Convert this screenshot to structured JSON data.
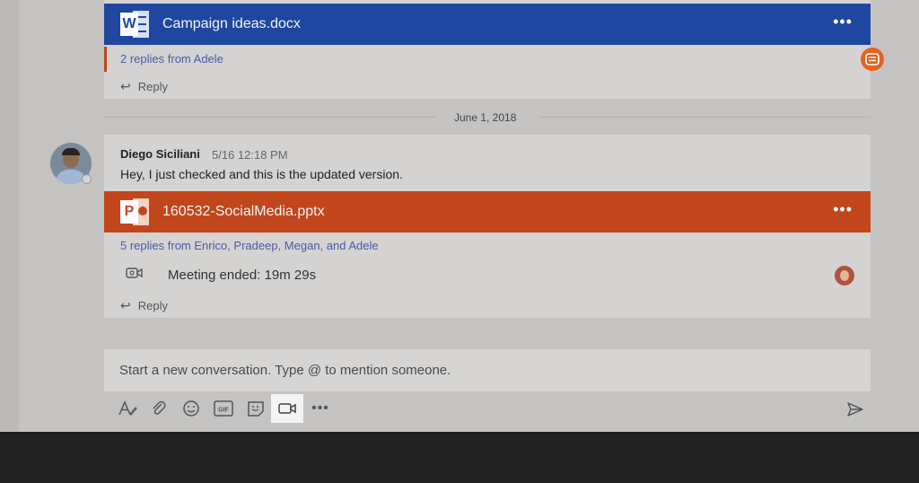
{
  "thread_top": {
    "file_name": "Campaign ideas.docx",
    "file_type": "word",
    "more_label": "•••",
    "replies_text": "2 replies from Adele",
    "reply_label": "Reply"
  },
  "date_divider": "June 1, 2018",
  "thread_main": {
    "sender": "Diego Siciliani",
    "time": "5/16 12:18 PM",
    "message": "Hey, I just checked and this is the updated version.",
    "file_name": "160532-SocialMedia.pptx",
    "file_type": "powerpoint",
    "more_label": "•••",
    "replies_text": "5 replies from Enrico, Pradeep, Megan, and Adele",
    "meeting_text": "Meeting ended: 19m 29s",
    "reply_label": "Reply"
  },
  "compose": {
    "placeholder": "Start a new conversation. Type @ to mention someone."
  },
  "toolbar": {
    "tools": [
      "format-icon",
      "attach-icon",
      "emoji-icon",
      "gif-icon",
      "sticker-icon",
      "meet-now-icon",
      "more-options-icon",
      "send-icon"
    ],
    "gif_label": "GIF",
    "more_label": "•••",
    "active_tool": "meet-now-icon"
  },
  "colors": {
    "word": "#1f47a0",
    "powerpoint": "#c1461c",
    "link": "#4b59a8",
    "accent": "#e3621f"
  }
}
